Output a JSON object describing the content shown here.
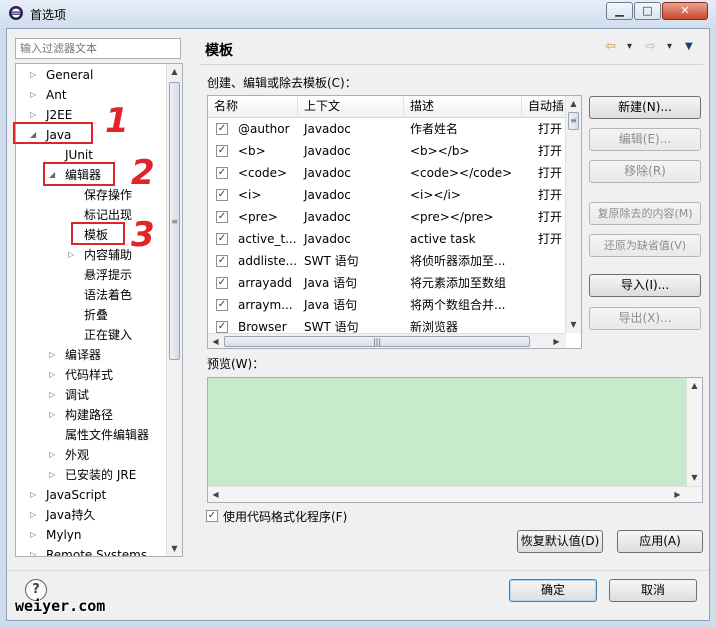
{
  "window": {
    "title": "首选项",
    "buttons": {
      "minimize": "▁",
      "maximize": "□",
      "close": "✕"
    }
  },
  "left": {
    "filter_placeholder": "输入过滤器文本",
    "tree": [
      {
        "label": "General",
        "twisty": "▷"
      },
      {
        "label": "Ant",
        "twisty": "▷"
      },
      {
        "label": "J2EE",
        "twisty": "▷"
      },
      {
        "label": "Java",
        "twisty": "◢"
      },
      {
        "label": "JUnit",
        "twisty": ""
      },
      {
        "label": "编辑器",
        "twisty": "◢"
      },
      {
        "label": "保存操作",
        "twisty": ""
      },
      {
        "label": "标记出现",
        "twisty": ""
      },
      {
        "label": "模板",
        "twisty": ""
      },
      {
        "label": "内容辅助",
        "twisty": "▷"
      },
      {
        "label": "悬浮提示",
        "twisty": ""
      },
      {
        "label": "语法着色",
        "twisty": ""
      },
      {
        "label": "折叠",
        "twisty": ""
      },
      {
        "label": "正在键入",
        "twisty": ""
      },
      {
        "label": "编译器",
        "twisty": "▷"
      },
      {
        "label": "代码样式",
        "twisty": "▷"
      },
      {
        "label": "调试",
        "twisty": "▷"
      },
      {
        "label": "构建路径",
        "twisty": "▷"
      },
      {
        "label": "属性文件编辑器",
        "twisty": ""
      },
      {
        "label": "外观",
        "twisty": "▷"
      },
      {
        "label": "已安装的 JRE",
        "twisty": "▷"
      },
      {
        "label": "JavaScript",
        "twisty": "▷"
      },
      {
        "label": "Java持久",
        "twisty": "▷"
      },
      {
        "label": "Mylyn",
        "twisty": "▷"
      },
      {
        "label": "Remote Systems",
        "twisty": "▷"
      }
    ],
    "annotations": [
      "1",
      "2",
      "3"
    ]
  },
  "right": {
    "title": "模板",
    "nav": {
      "back": "⇦",
      "dropdown": "▾",
      "forward": "⇨",
      "menu": "▼"
    },
    "templates_label": "创建、编辑或除去模板(C)：",
    "columns": [
      "名称",
      "上下文",
      "描述",
      "自动插"
    ],
    "rows": [
      {
        "name": "@author",
        "context": "Javadoc",
        "desc": "作者姓名",
        "auto": "打开"
      },
      {
        "name": "<b>",
        "context": "Javadoc",
        "desc": "<b></b>",
        "auto": "打开"
      },
      {
        "name": "<code>",
        "context": "Javadoc",
        "desc": "<code></code>",
        "auto": "打开"
      },
      {
        "name": "<i>",
        "context": "Javadoc",
        "desc": "<i></i>",
        "auto": "打开"
      },
      {
        "name": "<pre>",
        "context": "Javadoc",
        "desc": "<pre></pre>",
        "auto": "打开"
      },
      {
        "name": "active_t...",
        "context": "Javadoc",
        "desc": "active task",
        "auto": "打开"
      },
      {
        "name": "addliste...",
        "context": "SWT 语句",
        "desc": "将侦听器添加至...",
        "auto": ""
      },
      {
        "name": "arrayadd",
        "context": "Java 语句",
        "desc": "将元素添加至数组",
        "auto": ""
      },
      {
        "name": "arraym...",
        "context": "Java 语句",
        "desc": "将两个数组合并...",
        "auto": ""
      },
      {
        "name": "Browser",
        "context": "SWT 语句",
        "desc": "新浏览器",
        "auto": ""
      }
    ],
    "checkmark": "✓",
    "buttons": {
      "new": "新建(N)...",
      "edit": "编辑(E)...",
      "remove": "移除(R)",
      "restore_removed": "复原除去的内容(M)",
      "revert_default": "还原为缺省值(V)",
      "import": "导入(I)...",
      "export": "导出(X)..."
    },
    "preview_label": "预览(W)：",
    "use_formatter": "使用代码格式化程序(F)",
    "restore_defaults": "恢复默认值(D)",
    "apply": "应用(A)"
  },
  "footer": {
    "help": "?",
    "ok": "确定",
    "cancel": "取消",
    "watermark": "weiyer.com"
  },
  "colors": {
    "preview_bg": "#c6ebcb",
    "annotation_red": "#e0242a",
    "window_frame": "#cfdcec"
  }
}
